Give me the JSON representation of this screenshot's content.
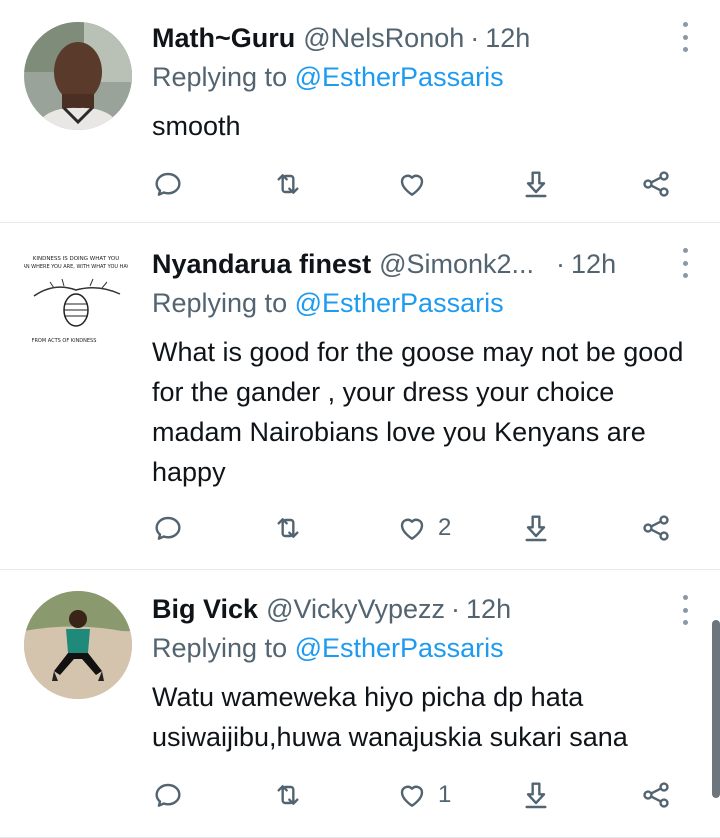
{
  "tweets": [
    {
      "name": "Math~Guru",
      "handle": "@NelsRonoh",
      "sep": "·",
      "time": "12h",
      "replying_prefix": "Replying to",
      "replying_to": "@EstherPassaris",
      "text": "smooth",
      "like_count": ""
    },
    {
      "name": "Nyandarua finest",
      "handle": "@Simonk2...",
      "sep": "·",
      "time": "12h",
      "replying_prefix": "Replying to",
      "replying_to": "@EstherPassaris",
      "text": "What is good for the goose may not be good for the gander , your dress your choice madam Nairobians love you Kenyans are happy",
      "like_count": "2",
      "avatar_caption_top": "KINDNESS IS DOING WHAT YOU CAN WHERE YOU ARE, WITH WHAT YOU HAVE",
      "avatar_caption_bottom": "FROM ACTS OF KINDNESS"
    },
    {
      "name": "Big Vick",
      "handle": "@VickyVypezz",
      "sep": "·",
      "time": "12h",
      "replying_prefix": "Replying to",
      "replying_to": "@EstherPassaris",
      "text": "Watu wameweka hiyo picha dp hata usiwaijibu,huwa wanajuskia sukari sana",
      "like_count": "1"
    }
  ],
  "icons": {
    "reply": "reply-icon",
    "retweet": "retweet-icon",
    "like": "heart-icon",
    "download": "download-icon",
    "share": "share-icon",
    "more": "more-vertical-icon"
  },
  "colors": {
    "link": "#1d9bf0",
    "secondary": "#536471",
    "icon": "#536471",
    "divider": "#e7e9ea"
  }
}
